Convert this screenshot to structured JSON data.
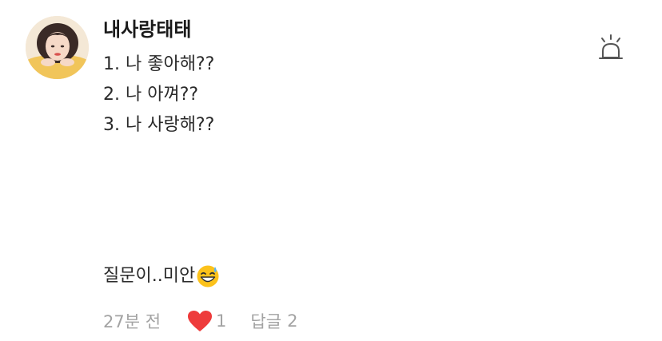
{
  "comment": {
    "author": "내사랑태태",
    "avatar_icon": "profile-photo",
    "report_icon": "siren-icon",
    "lines": [
      "1. 나 좋아해??",
      "2. 나 아껴??",
      "3. 나 사랑해??"
    ],
    "closing_text": "질문이..미안",
    "closing_emoji": "grinning-face-with-sweat-emoji",
    "time": "27분 전",
    "like_icon": "heart-icon",
    "like_color": "#ee3b3b",
    "like_count": "1",
    "reply_label": "답글",
    "reply_count": "2"
  }
}
